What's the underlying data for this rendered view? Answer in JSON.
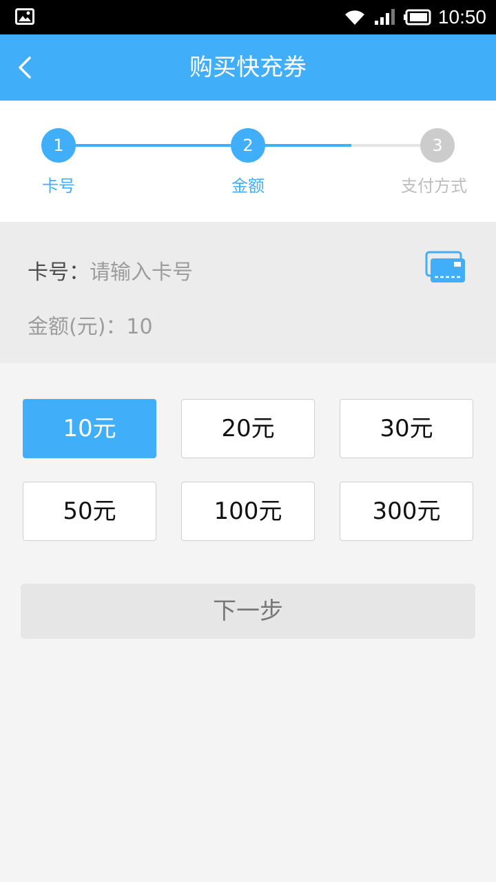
{
  "status_bar": {
    "time": "10:50",
    "icons": [
      "image-icon",
      "wifi-icon",
      "signal-icon",
      "battery-icon"
    ]
  },
  "header": {
    "title": "购买快充券",
    "back_icon": "chevron-left-icon",
    "color": "#40aef9"
  },
  "steps": [
    {
      "number": "1",
      "label": "卡号",
      "state": "done"
    },
    {
      "number": "2",
      "label": "金额",
      "state": "active"
    },
    {
      "number": "3",
      "label": "支付方式",
      "state": "pending"
    }
  ],
  "form": {
    "card_label": "卡号：",
    "card_placeholder": "请输入卡号",
    "amount_label": "金额(元)：",
    "amount_value": "10",
    "card_icon": "card-icon"
  },
  "amounts": [
    {
      "label": "10元",
      "selected": true
    },
    {
      "label": "20元",
      "selected": false
    },
    {
      "label": "30元",
      "selected": false
    },
    {
      "label": "50元",
      "selected": false
    },
    {
      "label": "100元",
      "selected": false
    },
    {
      "label": "300元",
      "selected": false
    }
  ],
  "next_button": "下一步",
  "colors": {
    "accent": "#40aef9",
    "inactive": "#cccccc",
    "background": "#f4f4f4"
  }
}
